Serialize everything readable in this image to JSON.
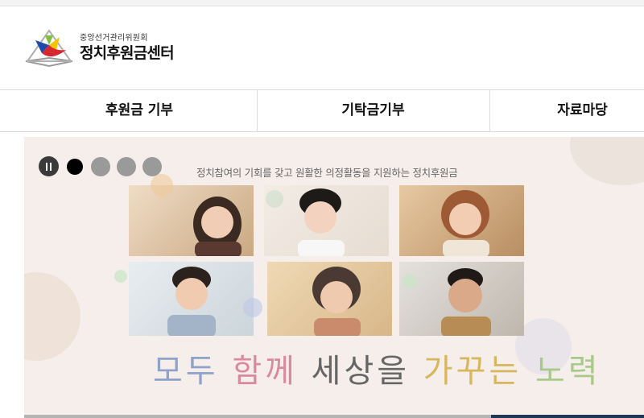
{
  "header": {
    "logo": {
      "subtitle": "중앙선거관리위원회",
      "title": "정치후원금센터",
      "colors": {
        "blue": "#1f4aa8",
        "yellow": "#f2c500",
        "red": "#d8282f",
        "green": "#7fbf3f",
        "gray": "#8a8a8a"
      }
    }
  },
  "nav": {
    "items": [
      {
        "label": "후원금 기부"
      },
      {
        "label": "기탁금기부"
      },
      {
        "label": "자료마당"
      }
    ]
  },
  "banner": {
    "background": "#f5eeeb",
    "tagline": "정치참여의 기회를 갖고 원활한 의정활동을 지원하는 정치후원금",
    "slider": {
      "slide_count": 4,
      "active_index": 1,
      "pause_icon": "pause-icon"
    },
    "slogan": {
      "parts": [
        {
          "text": "모두",
          "color": "#8fa2c9"
        },
        {
          "text": "함께",
          "color": "#d98aa0"
        },
        {
          "text": "세상을",
          "color": "#666666"
        },
        {
          "text": "가꾸는",
          "color": "#d8b75c"
        },
        {
          "text": "노력",
          "color": "#a9c98a"
        }
      ]
    }
  }
}
